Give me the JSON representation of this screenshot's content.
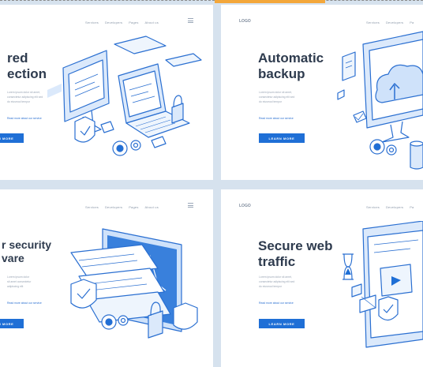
{
  "panels": [
    {
      "id": "secured-connection",
      "title_lines": [
        "red",
        "ection"
      ],
      "nav": [
        "Services",
        "Developers",
        "Pages",
        "About us"
      ],
      "description_lines": [
        "Lorem ipsum dolor sit amet,",
        "consectetur adipiscing elit sed",
        "do eiusmod tempor"
      ],
      "link": "Read more about our service",
      "button": "LEARN MORE"
    },
    {
      "id": "automatic-backup",
      "logo": "LOGO",
      "title_lines": [
        "Automatic",
        "backup"
      ],
      "nav": [
        "Services",
        "Developers",
        "Pa"
      ],
      "description_lines": [
        "Lorem ipsum dolor sit amet,",
        "consectetur adipiscing elit sed",
        "do eiusmod tempor"
      ],
      "link": "Read more about our service",
      "button": "LEARN MORE"
    },
    {
      "id": "security-software",
      "title_lines": [
        "r security",
        "vare"
      ],
      "nav": [
        "Services",
        "Developers",
        "Pages",
        "About us"
      ],
      "description_lines": [
        "Lorem ipsum dolor",
        "sit amet consectetur",
        "adipiscing elit"
      ],
      "link": "Read more about our service",
      "button": "LEARN MORE"
    },
    {
      "id": "secure-web-traffic",
      "logo": "LOGO",
      "title_lines": [
        "Secure web",
        "traffic"
      ],
      "nav": [
        "Services",
        "Developers",
        "Pa"
      ],
      "description_lines": [
        "Lorem ipsum dolor sit amet,",
        "consectetur adipiscing elit sed",
        "do eiusmod tempor"
      ],
      "link": "Read more about our service",
      "button": "LEARN MORE"
    }
  ],
  "colors": {
    "accent": "#1f6fd6",
    "line": "#2a6fd1",
    "light_fill": "#dbe9fb",
    "title": "#2e3b4e"
  },
  "icons": [
    "shield-icon",
    "padlock-icon",
    "gear-icon",
    "laptop-icon",
    "monitor-icon",
    "cloud-icon",
    "database-icon",
    "hourglass-icon",
    "menu-icon"
  ]
}
